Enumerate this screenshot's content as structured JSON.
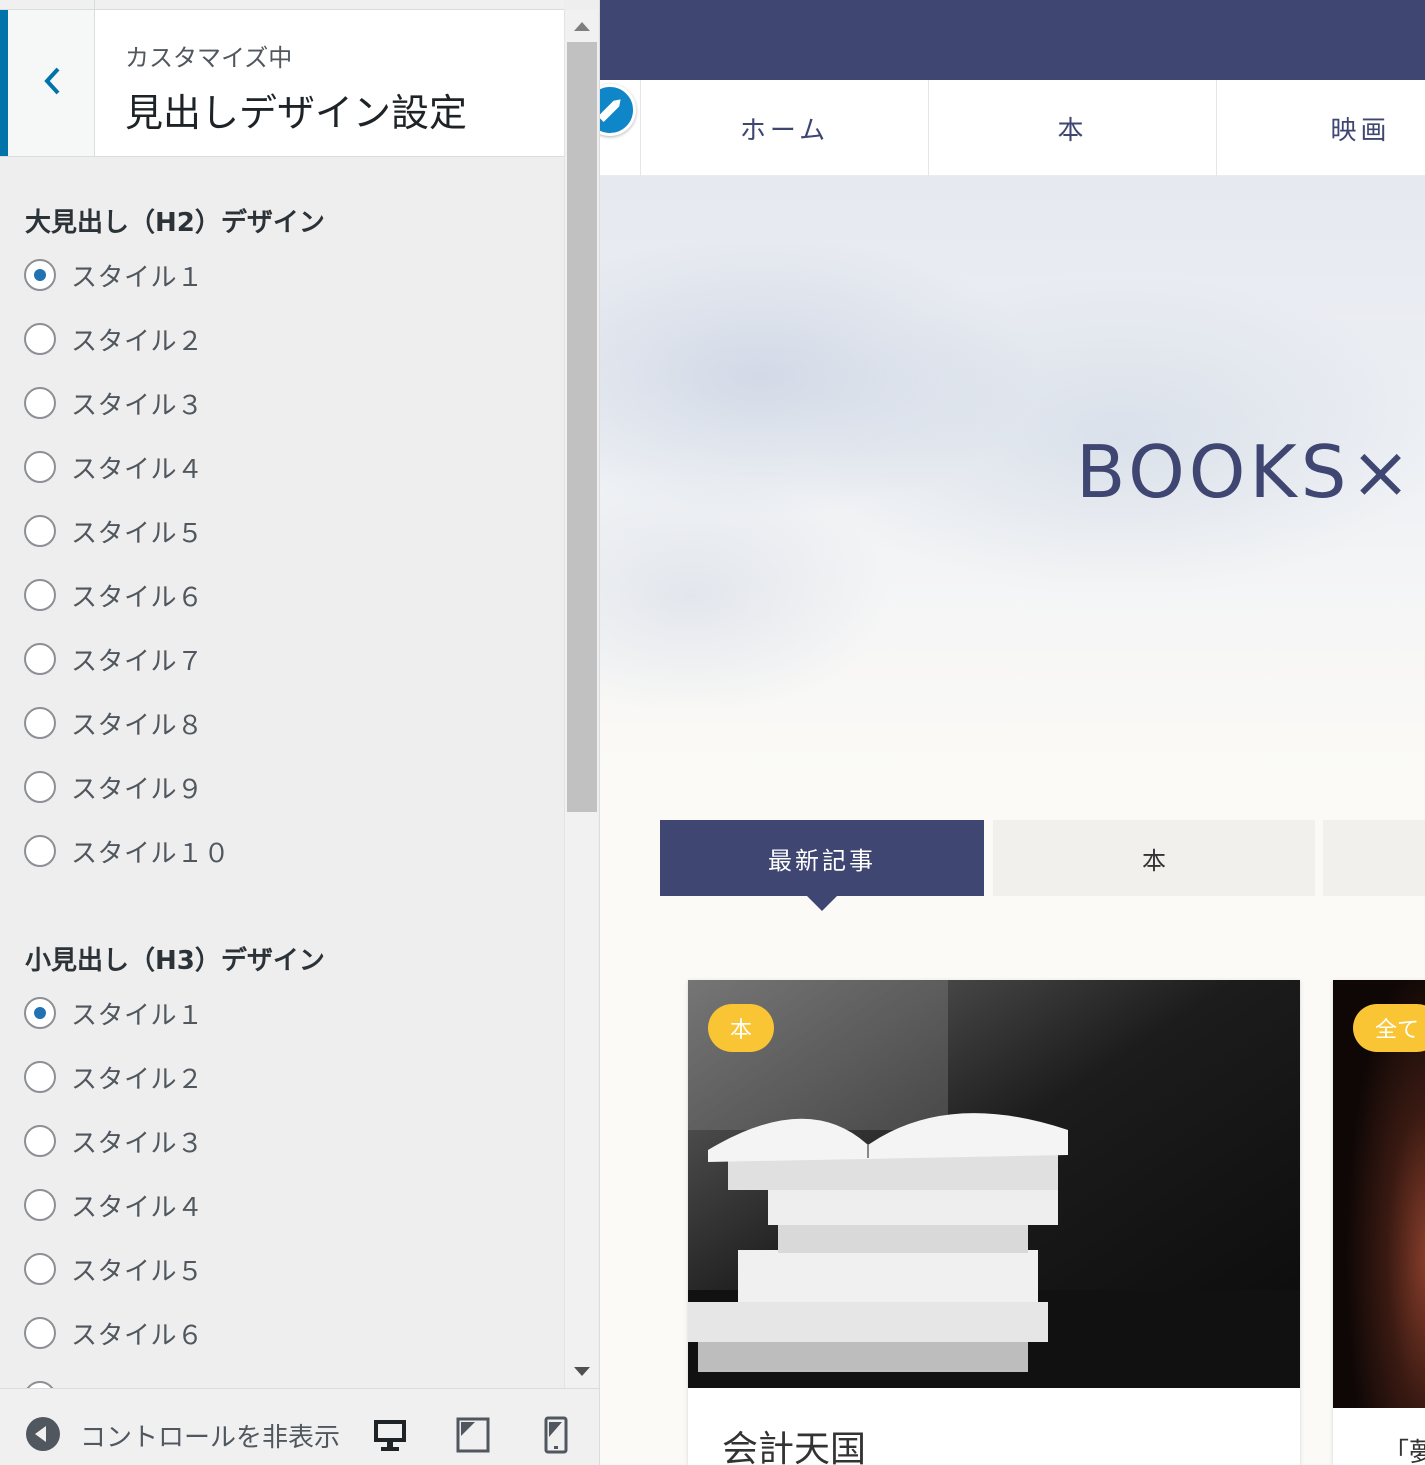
{
  "sidebar": {
    "subtitle": "カスタマイズ中",
    "title": "見出しデザイン設定",
    "sections": [
      {
        "title": "大見出し（H2）デザイン",
        "options": [
          "スタイル１",
          "スタイル２",
          "スタイル３",
          "スタイル４",
          "スタイル５",
          "スタイル６",
          "スタイル７",
          "スタイル８",
          "スタイル９",
          "スタイル１０"
        ],
        "selected": "スタイル１"
      },
      {
        "title": "小見出し（H3）デザイン",
        "options": [
          "スタイル１",
          "スタイル２",
          "スタイル３",
          "スタイル４",
          "スタイル５",
          "スタイル６"
        ],
        "selected": "スタイル１"
      }
    ],
    "footer": {
      "hide_controls_label": "コントロールを非表示",
      "devices": [
        "desktop-icon",
        "tablet-icon",
        "mobile-icon"
      ]
    },
    "accent_color": "#0073aa"
  },
  "preview": {
    "nav_items": [
      "ホーム",
      "本",
      "映画"
    ],
    "hero_title": "BOOKS×",
    "tabs": [
      "最新記事",
      "本",
      ""
    ],
    "cards": [
      {
        "badge": "本",
        "title": "会計天国"
      },
      {
        "badge": "全て",
        "title": "「夢"
      }
    ],
    "colors": {
      "brand": "#3e4671",
      "badge": "#f9c535",
      "edit": "#0f86c8"
    }
  }
}
